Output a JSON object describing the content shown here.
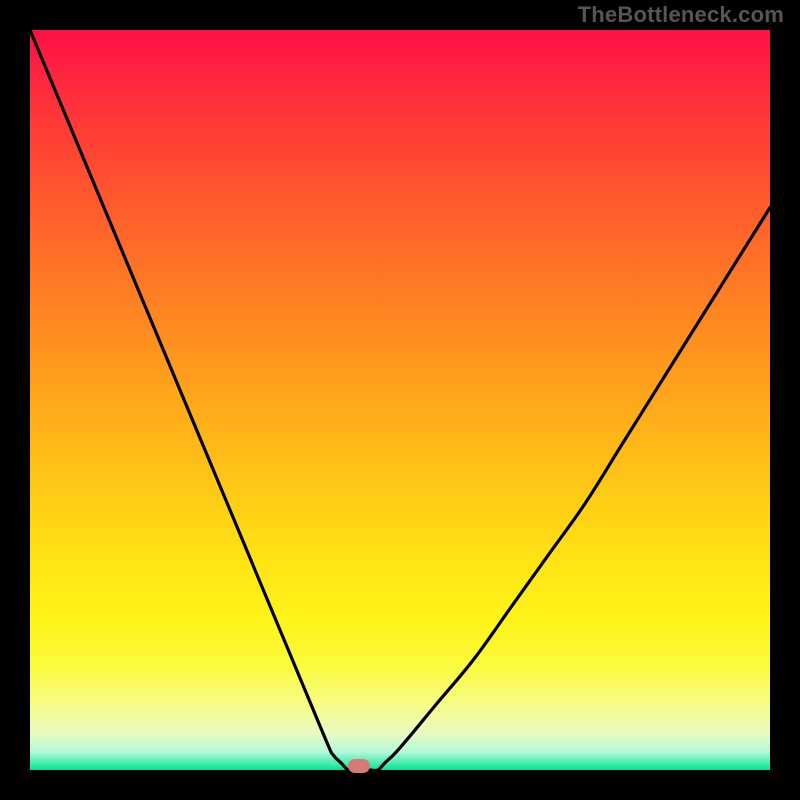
{
  "watermark": "TheBottleneck.com",
  "colors": {
    "frame": "#000000",
    "curve_stroke": "#000000",
    "marker_fill": "#d87a74",
    "watermark_text": "#565656"
  },
  "chart_data": {
    "type": "line",
    "title": "",
    "xlabel": "",
    "ylabel": "",
    "xlim": [
      0,
      100
    ],
    "ylim": [
      0,
      100
    ],
    "grid": false,
    "legend": false,
    "annotations": [],
    "series": [
      {
        "name": "bottleneck-curve",
        "x": [
          0,
          5,
          10,
          15,
          20,
          25,
          30,
          35,
          40,
          41,
          42,
          43,
          44,
          45,
          46,
          47,
          48,
          50,
          55,
          60,
          65,
          70,
          75,
          80,
          85,
          90,
          95,
          100
        ],
        "values": [
          100,
          88,
          76,
          64,
          52,
          40,
          28,
          16,
          4,
          2,
          1,
          0,
          0,
          0,
          0,
          0,
          1,
          3,
          9,
          15,
          22,
          29,
          36,
          44,
          52,
          60,
          68,
          76
        ]
      }
    ],
    "marker": {
      "x": 44.5,
      "y": 0
    },
    "notes": "V-shaped bottleneck curve on rainbow gradient; minimum (pink rounded marker) around x≈44-45%. Values are estimated from the unlabeled plot."
  }
}
